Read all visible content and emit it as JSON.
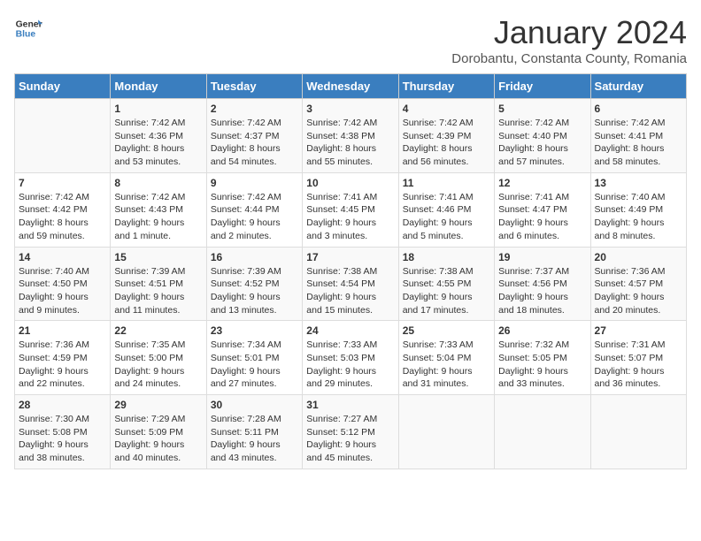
{
  "header": {
    "logo_general": "General",
    "logo_blue": "Blue",
    "month_title": "January 2024",
    "location": "Dorobantu, Constanta County, Romania"
  },
  "days_of_week": [
    "Sunday",
    "Monday",
    "Tuesday",
    "Wednesday",
    "Thursday",
    "Friday",
    "Saturday"
  ],
  "weeks": [
    [
      {
        "day": "",
        "sunrise": "",
        "sunset": "",
        "daylight": ""
      },
      {
        "day": "1",
        "sunrise": "Sunrise: 7:42 AM",
        "sunset": "Sunset: 4:36 PM",
        "daylight": "Daylight: 8 hours and 53 minutes."
      },
      {
        "day": "2",
        "sunrise": "Sunrise: 7:42 AM",
        "sunset": "Sunset: 4:37 PM",
        "daylight": "Daylight: 8 hours and 54 minutes."
      },
      {
        "day": "3",
        "sunrise": "Sunrise: 7:42 AM",
        "sunset": "Sunset: 4:38 PM",
        "daylight": "Daylight: 8 hours and 55 minutes."
      },
      {
        "day": "4",
        "sunrise": "Sunrise: 7:42 AM",
        "sunset": "Sunset: 4:39 PM",
        "daylight": "Daylight: 8 hours and 56 minutes."
      },
      {
        "day": "5",
        "sunrise": "Sunrise: 7:42 AM",
        "sunset": "Sunset: 4:40 PM",
        "daylight": "Daylight: 8 hours and 57 minutes."
      },
      {
        "day": "6",
        "sunrise": "Sunrise: 7:42 AM",
        "sunset": "Sunset: 4:41 PM",
        "daylight": "Daylight: 8 hours and 58 minutes."
      }
    ],
    [
      {
        "day": "7",
        "sunrise": "Sunrise: 7:42 AM",
        "sunset": "Sunset: 4:42 PM",
        "daylight": "Daylight: 8 hours and 59 minutes."
      },
      {
        "day": "8",
        "sunrise": "Sunrise: 7:42 AM",
        "sunset": "Sunset: 4:43 PM",
        "daylight": "Daylight: 9 hours and 1 minute."
      },
      {
        "day": "9",
        "sunrise": "Sunrise: 7:42 AM",
        "sunset": "Sunset: 4:44 PM",
        "daylight": "Daylight: 9 hours and 2 minutes."
      },
      {
        "day": "10",
        "sunrise": "Sunrise: 7:41 AM",
        "sunset": "Sunset: 4:45 PM",
        "daylight": "Daylight: 9 hours and 3 minutes."
      },
      {
        "day": "11",
        "sunrise": "Sunrise: 7:41 AM",
        "sunset": "Sunset: 4:46 PM",
        "daylight": "Daylight: 9 hours and 5 minutes."
      },
      {
        "day": "12",
        "sunrise": "Sunrise: 7:41 AM",
        "sunset": "Sunset: 4:47 PM",
        "daylight": "Daylight: 9 hours and 6 minutes."
      },
      {
        "day": "13",
        "sunrise": "Sunrise: 7:40 AM",
        "sunset": "Sunset: 4:49 PM",
        "daylight": "Daylight: 9 hours and 8 minutes."
      }
    ],
    [
      {
        "day": "14",
        "sunrise": "Sunrise: 7:40 AM",
        "sunset": "Sunset: 4:50 PM",
        "daylight": "Daylight: 9 hours and 9 minutes."
      },
      {
        "day": "15",
        "sunrise": "Sunrise: 7:39 AM",
        "sunset": "Sunset: 4:51 PM",
        "daylight": "Daylight: 9 hours and 11 minutes."
      },
      {
        "day": "16",
        "sunrise": "Sunrise: 7:39 AM",
        "sunset": "Sunset: 4:52 PM",
        "daylight": "Daylight: 9 hours and 13 minutes."
      },
      {
        "day": "17",
        "sunrise": "Sunrise: 7:38 AM",
        "sunset": "Sunset: 4:54 PM",
        "daylight": "Daylight: 9 hours and 15 minutes."
      },
      {
        "day": "18",
        "sunrise": "Sunrise: 7:38 AM",
        "sunset": "Sunset: 4:55 PM",
        "daylight": "Daylight: 9 hours and 17 minutes."
      },
      {
        "day": "19",
        "sunrise": "Sunrise: 7:37 AM",
        "sunset": "Sunset: 4:56 PM",
        "daylight": "Daylight: 9 hours and 18 minutes."
      },
      {
        "day": "20",
        "sunrise": "Sunrise: 7:36 AM",
        "sunset": "Sunset: 4:57 PM",
        "daylight": "Daylight: 9 hours and 20 minutes."
      }
    ],
    [
      {
        "day": "21",
        "sunrise": "Sunrise: 7:36 AM",
        "sunset": "Sunset: 4:59 PM",
        "daylight": "Daylight: 9 hours and 22 minutes."
      },
      {
        "day": "22",
        "sunrise": "Sunrise: 7:35 AM",
        "sunset": "Sunset: 5:00 PM",
        "daylight": "Daylight: 9 hours and 24 minutes."
      },
      {
        "day": "23",
        "sunrise": "Sunrise: 7:34 AM",
        "sunset": "Sunset: 5:01 PM",
        "daylight": "Daylight: 9 hours and 27 minutes."
      },
      {
        "day": "24",
        "sunrise": "Sunrise: 7:33 AM",
        "sunset": "Sunset: 5:03 PM",
        "daylight": "Daylight: 9 hours and 29 minutes."
      },
      {
        "day": "25",
        "sunrise": "Sunrise: 7:33 AM",
        "sunset": "Sunset: 5:04 PM",
        "daylight": "Daylight: 9 hours and 31 minutes."
      },
      {
        "day": "26",
        "sunrise": "Sunrise: 7:32 AM",
        "sunset": "Sunset: 5:05 PM",
        "daylight": "Daylight: 9 hours and 33 minutes."
      },
      {
        "day": "27",
        "sunrise": "Sunrise: 7:31 AM",
        "sunset": "Sunset: 5:07 PM",
        "daylight": "Daylight: 9 hours and 36 minutes."
      }
    ],
    [
      {
        "day": "28",
        "sunrise": "Sunrise: 7:30 AM",
        "sunset": "Sunset: 5:08 PM",
        "daylight": "Daylight: 9 hours and 38 minutes."
      },
      {
        "day": "29",
        "sunrise": "Sunrise: 7:29 AM",
        "sunset": "Sunset: 5:09 PM",
        "daylight": "Daylight: 9 hours and 40 minutes."
      },
      {
        "day": "30",
        "sunrise": "Sunrise: 7:28 AM",
        "sunset": "Sunset: 5:11 PM",
        "daylight": "Daylight: 9 hours and 43 minutes."
      },
      {
        "day": "31",
        "sunrise": "Sunrise: 7:27 AM",
        "sunset": "Sunset: 5:12 PM",
        "daylight": "Daylight: 9 hours and 45 minutes."
      },
      {
        "day": "",
        "sunrise": "",
        "sunset": "",
        "daylight": ""
      },
      {
        "day": "",
        "sunrise": "",
        "sunset": "",
        "daylight": ""
      },
      {
        "day": "",
        "sunrise": "",
        "sunset": "",
        "daylight": ""
      }
    ]
  ]
}
